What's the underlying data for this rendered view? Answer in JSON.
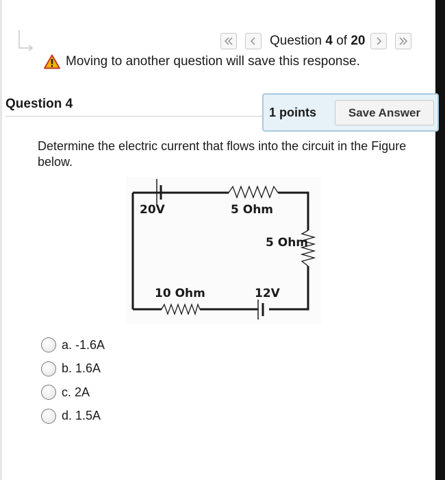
{
  "navigation": {
    "question_label": "Question",
    "current": "4",
    "of_label": "of",
    "total": "20"
  },
  "warning": "Moving to another question will save this response.",
  "question": {
    "title": "Question 4",
    "points": "1 points",
    "save_label": "Save Answer",
    "prompt": "Determine the electric current that flows into the circuit in the Figure below."
  },
  "circuit": {
    "labels": {
      "battery_1": "20V",
      "resistor_top": "5 Ohm",
      "resistor_right": "5 Ohm",
      "resistor_bottom": "10 Ohm",
      "battery_2": "12V"
    }
  },
  "options": [
    {
      "letter": "a.",
      "text": "-1.6A"
    },
    {
      "letter": "b.",
      "text": "1.6A"
    },
    {
      "letter": "c.",
      "text": "2A"
    },
    {
      "letter": "d.",
      "text": "1.5A"
    }
  ]
}
